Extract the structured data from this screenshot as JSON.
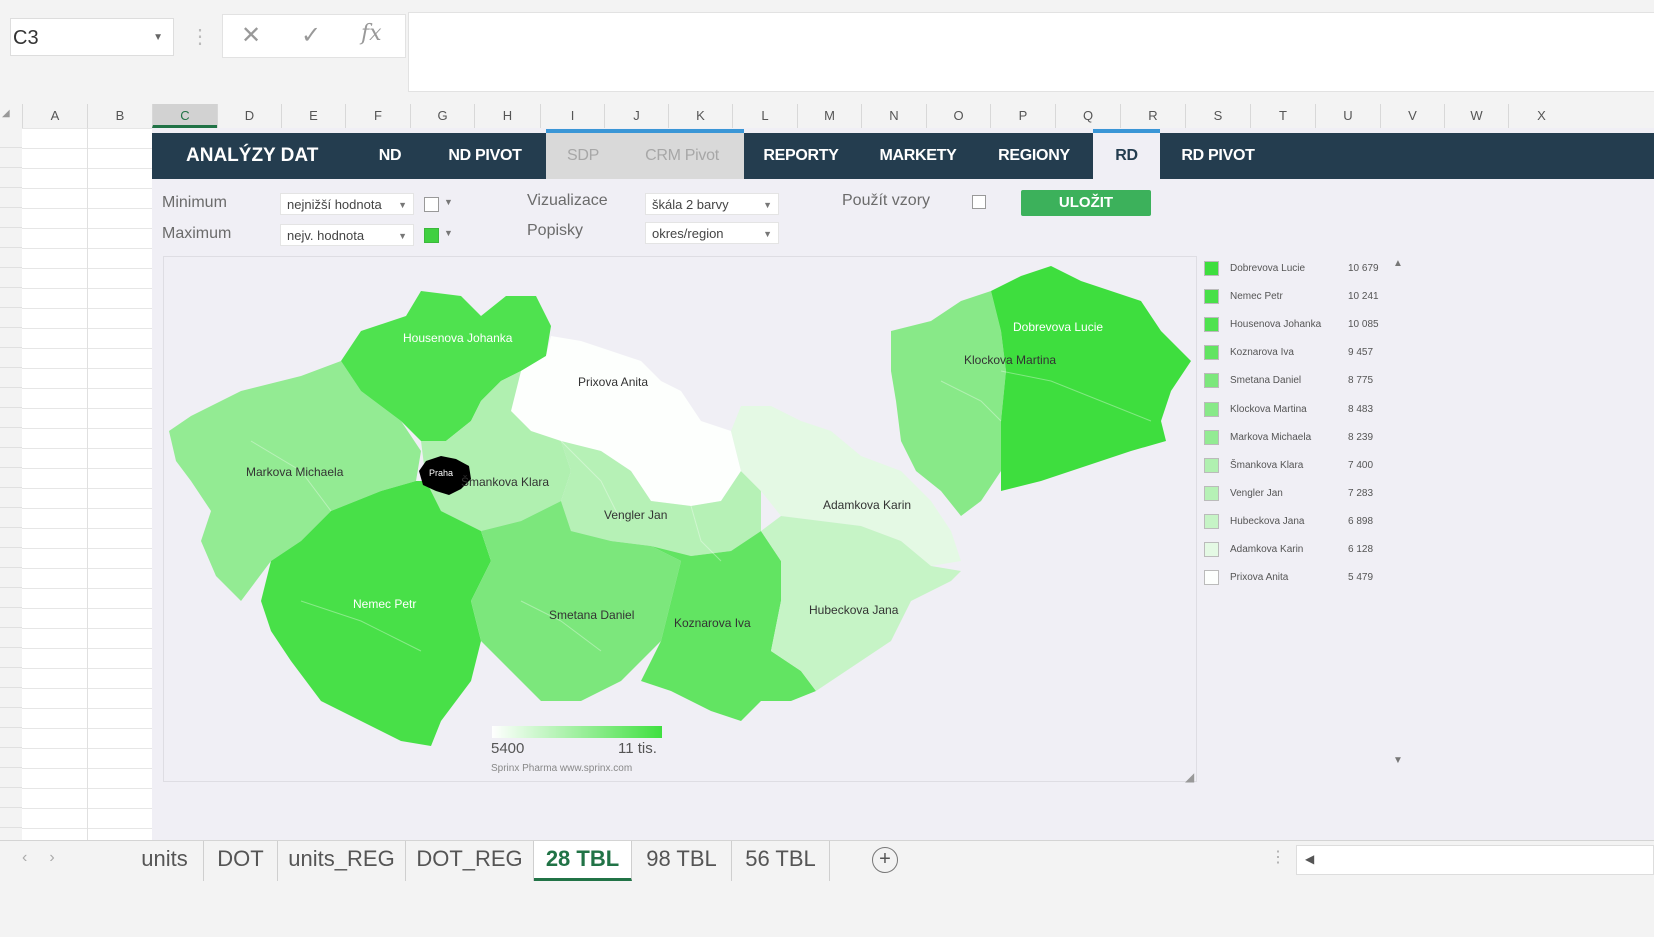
{
  "formula_bar": {
    "name_box": "C3",
    "cancel_icon": "✕",
    "enter_icon": "✓",
    "fx_label": "fx",
    "formula": ""
  },
  "columns": [
    "A",
    "B",
    "C",
    "D",
    "E",
    "F",
    "G",
    "H",
    "I",
    "J",
    "K",
    "L",
    "M",
    "N",
    "O",
    "P",
    "Q",
    "R",
    "S",
    "T",
    "U",
    "V",
    "W",
    "X"
  ],
  "selected_column": "C",
  "nav": {
    "brand": "ANALÝZY DAT",
    "items": [
      {
        "label": "ND",
        "state": "normal"
      },
      {
        "label": "ND PIVOT",
        "state": "normal"
      },
      {
        "label": "SDP",
        "state": "disabled"
      },
      {
        "label": "CRM Pivot",
        "state": "disabled"
      },
      {
        "label": "REPORTY",
        "state": "normal"
      },
      {
        "label": "MARKETY",
        "state": "normal"
      },
      {
        "label": "REGIONY",
        "state": "normal"
      },
      {
        "label": "RD",
        "state": "active"
      },
      {
        "label": "RD PIVOT",
        "state": "normal"
      }
    ]
  },
  "controls": {
    "minimum_label": "Minimum",
    "minimum_value": "nejnižší hodnota",
    "maximum_label": "Maximum",
    "maximum_value": "nejv. hodnota",
    "min_color": "#ffffff",
    "max_color": "#40d040",
    "vizualizace_label": "Vizualizace",
    "vizualizace_value": "škála 2 barvy",
    "popisky_label": "Popisky",
    "popisky_value": "okres/region",
    "pouzit_vzory_label": "Použít vzory",
    "pouzit_vzory_checked": false,
    "save_label": "ULOŽIT"
  },
  "map": {
    "scale_min": "5400",
    "scale_max": "11 tis.",
    "credit": "Sprinx Pharma www.sprinx.com",
    "labels": [
      {
        "text": "Housenova Johanka",
        "white": true
      },
      {
        "text": "Prixova Anita",
        "white": false
      },
      {
        "text": "Markova Michaela",
        "white": false
      },
      {
        "text": "Praha",
        "white": true
      },
      {
        "text": "Šmankova Klara",
        "white": false
      },
      {
        "text": "Vengler Jan",
        "white": false
      },
      {
        "text": "Adamkova Karin",
        "white": false
      },
      {
        "text": "Nemec Petr",
        "white": true
      },
      {
        "text": "Smetana Daniel",
        "white": false
      },
      {
        "text": "Koznarova Iva",
        "white": false
      },
      {
        "text": "Hubeckova Jana",
        "white": false
      },
      {
        "text": "Dobrevova Lucie",
        "white": true
      },
      {
        "text": "Klockova Martina",
        "white": false
      }
    ]
  },
  "legend": [
    {
      "name": "Dobrevova Lucie",
      "value": "10 679",
      "color": "#3ede3e"
    },
    {
      "name": "Nemec Petr",
      "value": "10 241",
      "color": "#48e048"
    },
    {
      "name": "Housenova Johanka",
      "value": "10 085",
      "color": "#4fe24f"
    },
    {
      "name": "Koznarova Iva",
      "value": "9 457",
      "color": "#62e462"
    },
    {
      "name": "Smetana Daniel",
      "value": "8 775",
      "color": "#7ce77c"
    },
    {
      "name": "Klockova Martina",
      "value": "8 483",
      "color": "#88e988"
    },
    {
      "name": "Markova Michaela",
      "value": "8 239",
      "color": "#93eb93"
    },
    {
      "name": "Šmankova Klara",
      "value": "7 400",
      "color": "#b0f0b0"
    },
    {
      "name": "Vengler Jan",
      "value": "7 283",
      "color": "#b6f1b6"
    },
    {
      "name": "Hubeckova Jana",
      "value": "6 898",
      "color": "#c6f4c6"
    },
    {
      "name": "Adamkova Karin",
      "value": "6 128",
      "color": "#e4f9e4"
    },
    {
      "name": "Prixova Anita",
      "value": "5 479",
      "color": "#fdfffd"
    }
  ],
  "sheet_tabs": [
    {
      "label": "units",
      "active": false
    },
    {
      "label": "DOT",
      "active": false
    },
    {
      "label": "units_REG",
      "active": false
    },
    {
      "label": "DOT_REG",
      "active": false
    },
    {
      "label": "28 TBL",
      "active": true
    },
    {
      "label": "98 TBL",
      "active": false
    },
    {
      "label": "56 TBL",
      "active": false
    }
  ],
  "add_sheet_icon": "+"
}
